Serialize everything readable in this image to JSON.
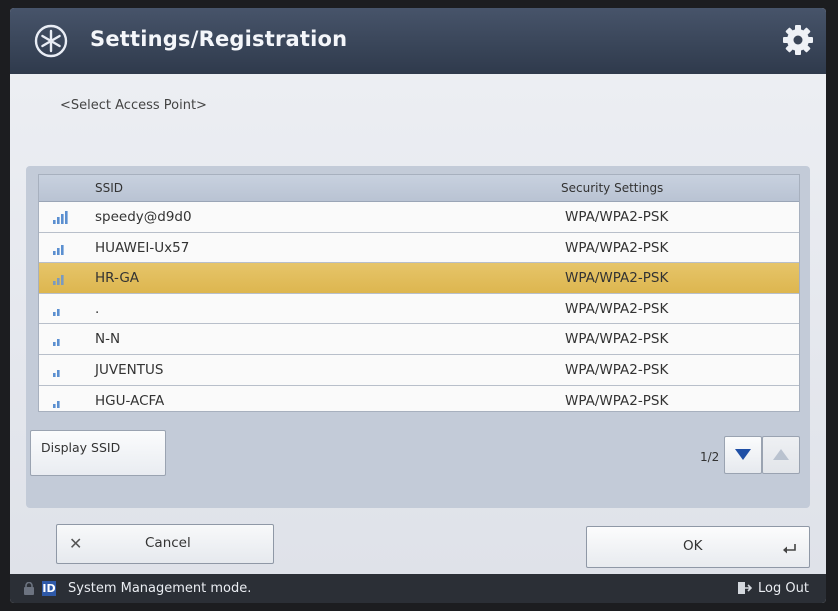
{
  "header": {
    "title": "Settings/Registration",
    "icon": "settings-star-icon",
    "gear_icon": "gear-icon"
  },
  "subtitle": "<Select Access Point>",
  "table": {
    "columns": [
      "SSID",
      "Security Settings"
    ],
    "rows": [
      {
        "ssid": "speedy@d9d0",
        "security": "WPA/WPA2-PSK",
        "signal": 4,
        "selected": false
      },
      {
        "ssid": "HUAWEI-Ux57",
        "security": "WPA/WPA2-PSK",
        "signal": 3,
        "selected": false
      },
      {
        "ssid": "HR-GA",
        "security": "WPA/WPA2-PSK",
        "signal": 3,
        "selected": true
      },
      {
        "ssid": ".",
        "security": "WPA/WPA2-PSK",
        "signal": 2,
        "selected": false
      },
      {
        "ssid": "N-N",
        "security": "WPA/WPA2-PSK",
        "signal": 2,
        "selected": false
      },
      {
        "ssid": "JUVENTUS",
        "security": "WPA/WPA2-PSK",
        "signal": 2,
        "selected": false
      },
      {
        "ssid": "HGU-ACFA",
        "security": "WPA/WPA2-PSK",
        "signal": 2,
        "selected": false
      }
    ]
  },
  "display_ssid_label": "Display SSID",
  "pagination": {
    "indicator": "1/2"
  },
  "buttons": {
    "cancel": "Cancel",
    "ok": "OK"
  },
  "status": {
    "mode": "System Management mode.",
    "id_badge": "ID",
    "logout": "Log Out"
  },
  "colors": {
    "selected_row": "#ddb64f",
    "signal": "#5b8fd0",
    "titlebar": "#3a4558"
  }
}
